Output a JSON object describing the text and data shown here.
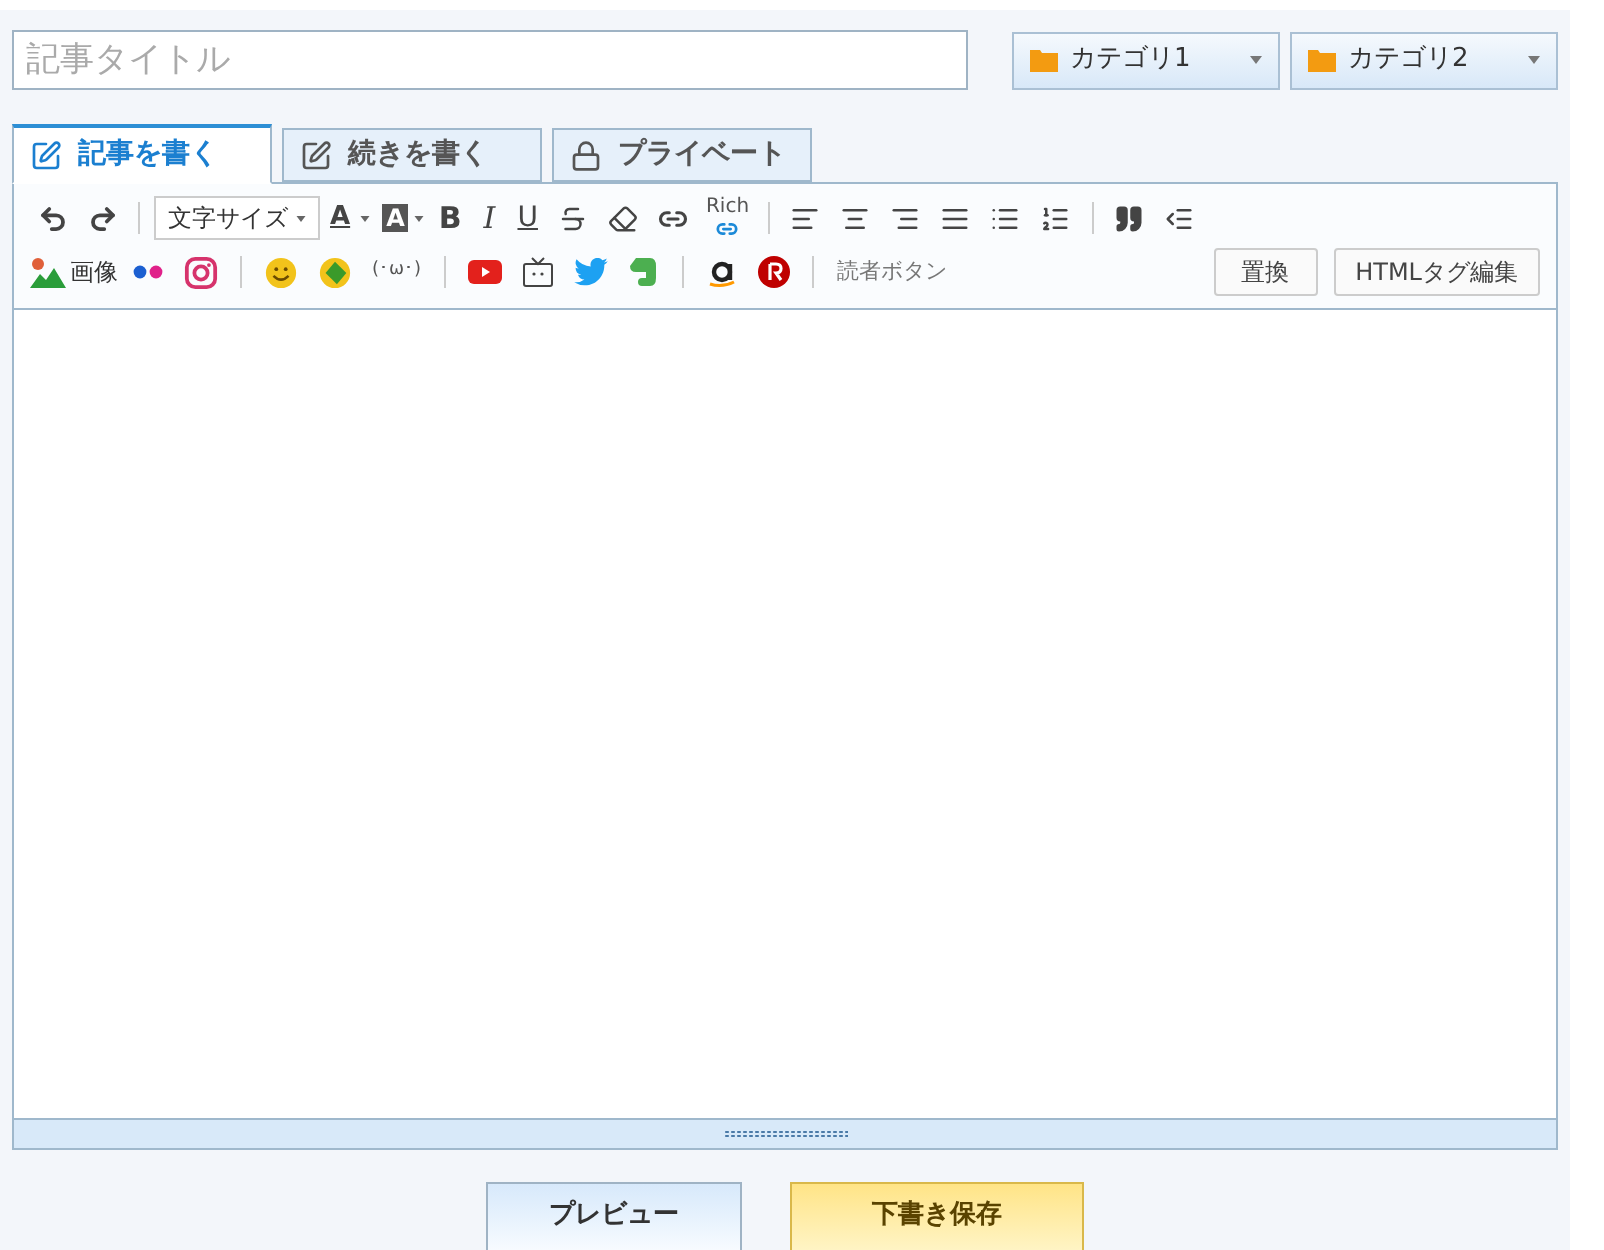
{
  "title_field": {
    "placeholder": "記事タイトル"
  },
  "categories": [
    {
      "label": "カテゴリ1"
    },
    {
      "label": "カテゴリ2"
    }
  ],
  "tabs": [
    {
      "label": "記事を書く",
      "selected": true
    },
    {
      "label": "続きを書く",
      "selected": false
    },
    {
      "label": "プライベート",
      "selected": false
    }
  ],
  "toolbar": {
    "font_size": "文字サイズ",
    "text_color": "A",
    "background_color": "A",
    "bold": "B",
    "italic": "I",
    "underline": "U",
    "rich_link": "Rich",
    "image": "画像",
    "kaomoji": "(･ω･)",
    "reader_button": "読者ボタン",
    "replace_button": "置換",
    "html_button": "HTMLタグ編集"
  },
  "buttons": [
    {
      "label": "プレビュー",
      "kind": "preview"
    },
    {
      "label": "下書き保存",
      "kind": "save"
    }
  ]
}
